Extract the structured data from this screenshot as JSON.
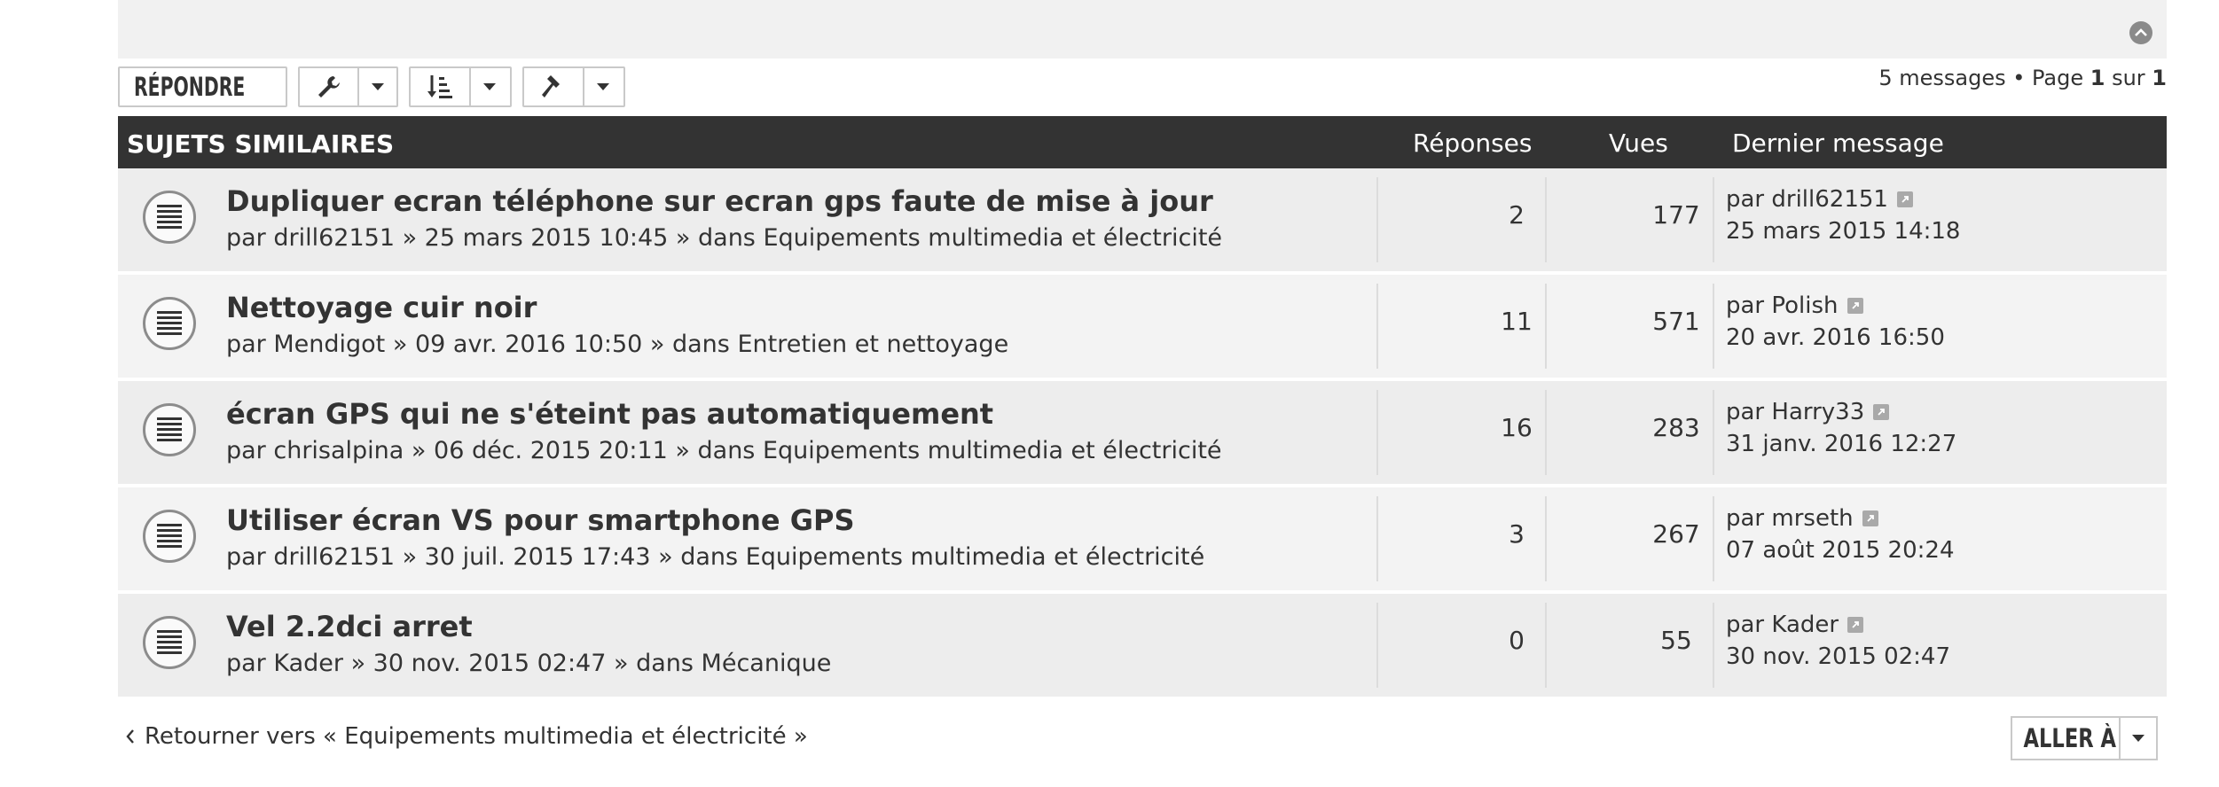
{
  "toolbar": {
    "reply_label": "RÉPONDRE",
    "icons": [
      "reply-arrow-icon",
      "wrench-icon",
      "sort-icon",
      "hammer-icon",
      "caret-down-icon"
    ]
  },
  "pagination": {
    "messages": "5 messages • Page ",
    "current": "1",
    "of": " sur ",
    "total": "1"
  },
  "table": {
    "header_title": "SUJETS SIMILAIRES",
    "col_replies": "Réponses",
    "col_views": "Vues",
    "col_last": "Dernier message",
    "rows": [
      {
        "title": "Dupliquer ecran téléphone sur ecran gps faute de mise à jour",
        "meta": "par drill62151 » 25 mars 2015 10:45 » dans Equipements multimedia et électricité",
        "replies": "2",
        "views": "177",
        "last_by": "par drill62151",
        "last_date": "25 mars 2015 14:18"
      },
      {
        "title": "Nettoyage cuir noir",
        "meta": "par Mendigot » 09 avr. 2016 10:50 » dans Entretien et nettoyage",
        "replies": "11",
        "views": "571",
        "last_by": "par Polish",
        "last_date": "20 avr. 2016 16:50"
      },
      {
        "title": "écran GPS qui ne s'éteint pas automatiquement",
        "meta": "par chrisalpina » 06 déc. 2015 20:11 » dans Equipements multimedia et électricité",
        "replies": "16",
        "views": "283",
        "last_by": "par Harry33",
        "last_date": "31 janv. 2016 12:27"
      },
      {
        "title": "Utiliser écran VS pour smartphone GPS",
        "meta": "par drill62151 » 30 juil. 2015 17:43 » dans Equipements multimedia et électricité",
        "replies": "3",
        "views": "267",
        "last_by": "par mrseth",
        "last_date": "07 août 2015 20:24"
      },
      {
        "title": "Vel 2.2dci arret",
        "meta": "par Kader » 30 nov. 2015 02:47 » dans Mécanique",
        "replies": "0",
        "views": "55",
        "last_by": "par Kader",
        "last_date": "30 nov. 2015 02:47"
      }
    ]
  },
  "footer": {
    "back_link": "Retourner vers « Equipements multimedia et électricité »",
    "jump_label": "ALLER À"
  }
}
